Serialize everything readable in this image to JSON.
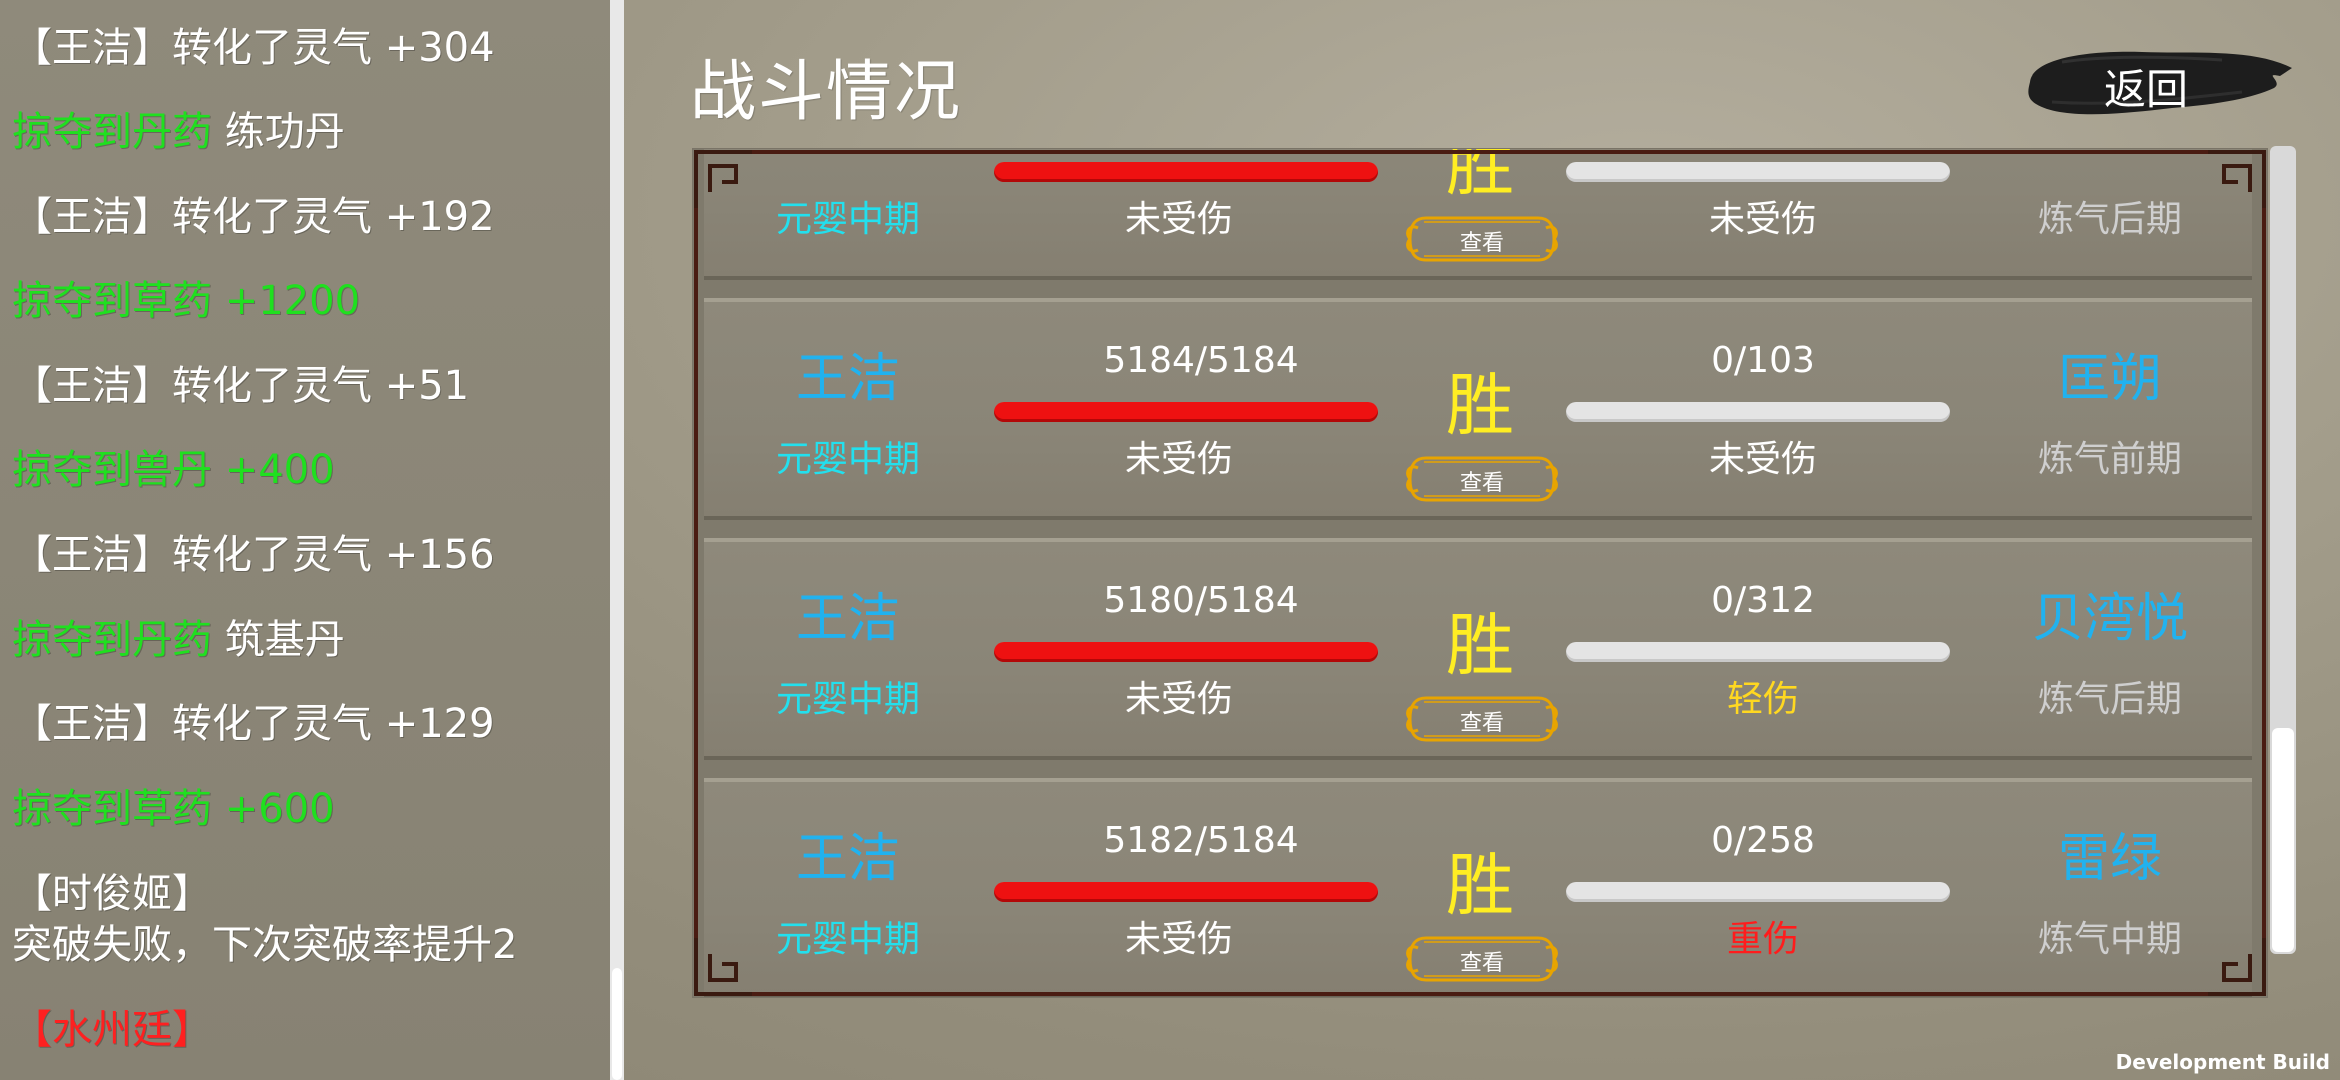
{
  "log": {
    "lines": [
      {
        "parts": [
          {
            "text": "【王洁】转化了灵气 +304",
            "color": "white"
          }
        ]
      },
      {
        "parts": [
          {
            "text": "掠夺到丹药 ",
            "color": "green"
          },
          {
            "text": "练功丹",
            "color": "white"
          }
        ]
      },
      {
        "parts": [
          {
            "text": "【王洁】转化了灵气 +192",
            "color": "white"
          }
        ]
      },
      {
        "parts": [
          {
            "text": "掠夺到草药 +1200",
            "color": "green"
          }
        ]
      },
      {
        "parts": [
          {
            "text": "【王洁】转化了灵气 +51",
            "color": "white"
          }
        ]
      },
      {
        "parts": [
          {
            "text": "掠夺到兽丹 +400",
            "color": "green"
          }
        ]
      },
      {
        "parts": [
          {
            "text": "【王洁】转化了灵气 +156",
            "color": "white"
          }
        ]
      },
      {
        "parts": [
          {
            "text": "掠夺到丹药 ",
            "color": "green"
          },
          {
            "text": "筑基丹",
            "color": "white"
          }
        ]
      },
      {
        "parts": [
          {
            "text": "【王洁】转化了灵气 +129",
            "color": "white"
          }
        ]
      },
      {
        "parts": [
          {
            "text": "掠夺到草药 +600",
            "color": "green"
          }
        ]
      },
      {
        "parts": [
          {
            "text": "【时俊姬】",
            "color": "white"
          }
        ]
      },
      {
        "parts": [
          {
            "text": "突破失败，下次突破率提升2",
            "color": "white"
          }
        ]
      },
      {
        "parts": [
          {
            "text": "【水州廷】",
            "color": "red"
          }
        ]
      }
    ]
  },
  "header": {
    "title": "战斗情况",
    "back_label": "返回"
  },
  "battles": [
    {
      "left_name": "",
      "left_realm": "元婴中期",
      "left_hp": "",
      "left_hp_fraction": 1.0,
      "left_status": "未受伤",
      "result": "胜",
      "view_label": "查看",
      "right_hp": "",
      "right_hp_fraction": 0.0,
      "right_status": "未受伤",
      "right_status_color": "#ffffff",
      "right_name": "",
      "right_realm": "炼气后期"
    },
    {
      "left_name": "王洁",
      "left_realm": "元婴中期",
      "left_hp": "5184/5184",
      "left_hp_fraction": 1.0,
      "left_status": "未受伤",
      "result": "胜",
      "view_label": "查看",
      "right_hp": "0/103",
      "right_hp_fraction": 0.0,
      "right_status": "未受伤",
      "right_status_color": "#ffffff",
      "right_name": "匡朔",
      "right_realm": "炼气前期"
    },
    {
      "left_name": "王洁",
      "left_realm": "元婴中期",
      "left_hp": "5180/5184",
      "left_hp_fraction": 0.999,
      "left_status": "未受伤",
      "result": "胜",
      "view_label": "查看",
      "right_hp": "0/312",
      "right_hp_fraction": 0.0,
      "right_status": "轻伤",
      "right_status_color": "#ffd820",
      "right_name": "贝湾悦",
      "right_realm": "炼气后期"
    },
    {
      "left_name": "王洁",
      "left_realm": "元婴中期",
      "left_hp": "5182/5184",
      "left_hp_fraction": 0.999,
      "left_status": "未受伤",
      "result": "胜",
      "view_label": "查看",
      "right_hp": "0/258",
      "right_hp_fraction": 0.0,
      "right_status": "重伤",
      "right_status_color": "#ff1c1c",
      "right_name": "雷绿",
      "right_realm": "炼气中期"
    }
  ],
  "footer": {
    "dev_build": "Development Build"
  },
  "colors": {
    "green": "#1fe01f",
    "red": "#ff2020",
    "white": "#ffffff",
    "name_blue": "#21b2ef",
    "realm_cyan": "#22e0ee",
    "result_yellow": "#ffee22",
    "hp_red": "#ee1111"
  }
}
